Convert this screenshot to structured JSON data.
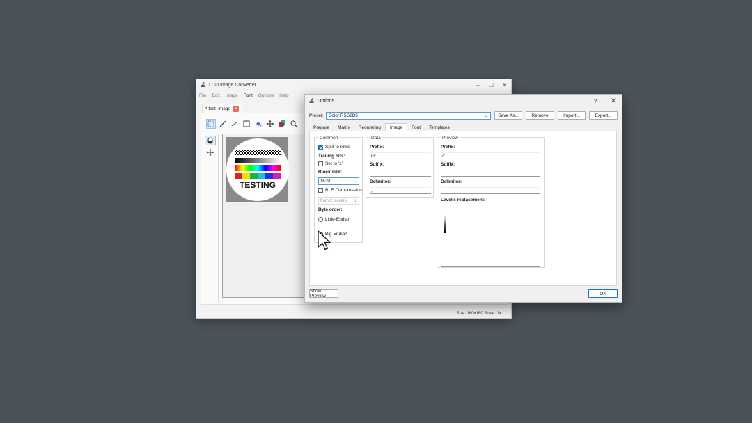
{
  "main_window": {
    "title": "LCD Image Converter",
    "menu": [
      "File",
      "Edit",
      "Image",
      "Font",
      "Options",
      "Help"
    ],
    "doc_tab": "* test_image",
    "canvas_text": "TESTING",
    "status": "Size: 160x160  Scale: 1x"
  },
  "dialog": {
    "title": "Options",
    "help": "?",
    "preset": {
      "label": "Preset:",
      "value": "Color R5G6B5"
    },
    "buttons": {
      "save_as": "Save As...",
      "remove": "Remove",
      "import": "Import...",
      "export": "Export...",
      "show_preview": "Show Preview",
      "ok": "OK"
    },
    "tabs": [
      "Prepare",
      "Matrix",
      "Reordering",
      "Image",
      "Font",
      "Templates"
    ],
    "active_tab": "Image",
    "common": {
      "legend": "Common",
      "split_to_rows": "Split to rows",
      "trailing_bits": "Trailing bits:",
      "set_to_1": "Set to '1'",
      "block_size_label": "Block size:",
      "block_size_value": "16 bit",
      "rle": "RLE Compression",
      "rle_from": "from 2 block(s)",
      "byte_order": "Byte order:",
      "little_endian": "Little-Endian",
      "big_endian": "Big-Endian"
    },
    "data": {
      "legend": "Data",
      "prefix_label": "Prefix:",
      "prefix_value": "0x",
      "suffix_label": "Suffix:",
      "suffix_value": "",
      "delimiter_label": "Delimiter:",
      "delimiter_value": ","
    },
    "preview": {
      "legend": "Preview",
      "prefix_label": "Prefix:",
      "prefix_value": "//",
      "suffix_label": "Suffix:",
      "suffix_value": "",
      "delimiter_label": "Delimiter:",
      "delimiter_value": "",
      "levels_label": "Level's replacement:",
      "levels_first": "."
    }
  },
  "colors": {
    "background": "#4a535a",
    "accent": "#1a73c8",
    "close_tab": "#e06c5a"
  }
}
